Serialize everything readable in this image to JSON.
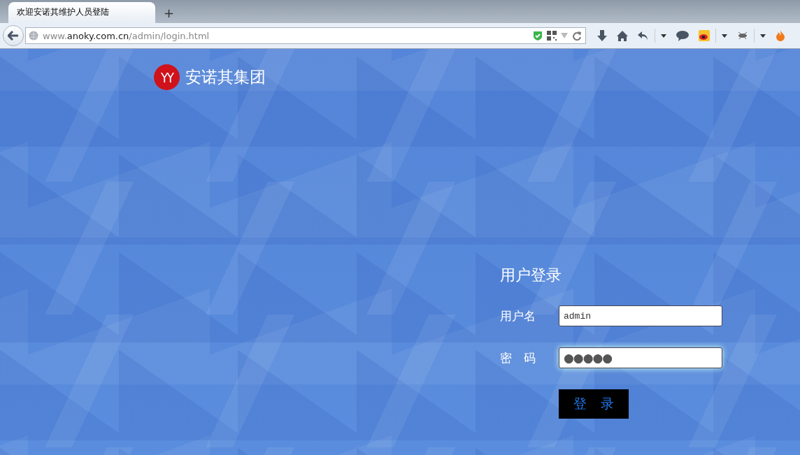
{
  "browser": {
    "tab": {
      "title": "欢迎安诺其维护人员登陆",
      "selected": true
    },
    "new_tab": "+",
    "url": {
      "prefix": "www.",
      "host": "anoky.com.cn",
      "path": "/admin/login.html"
    }
  },
  "brand": {
    "logo": "YY",
    "name": "安诺其集团"
  },
  "login": {
    "title": "用户登录",
    "fields": [
      {
        "label": "用户名",
        "value": "admin",
        "kind": "text"
      },
      {
        "label": "密 码",
        "value": "●●●●●",
        "kind": "password"
      }
    ],
    "submit": "登 录"
  }
}
